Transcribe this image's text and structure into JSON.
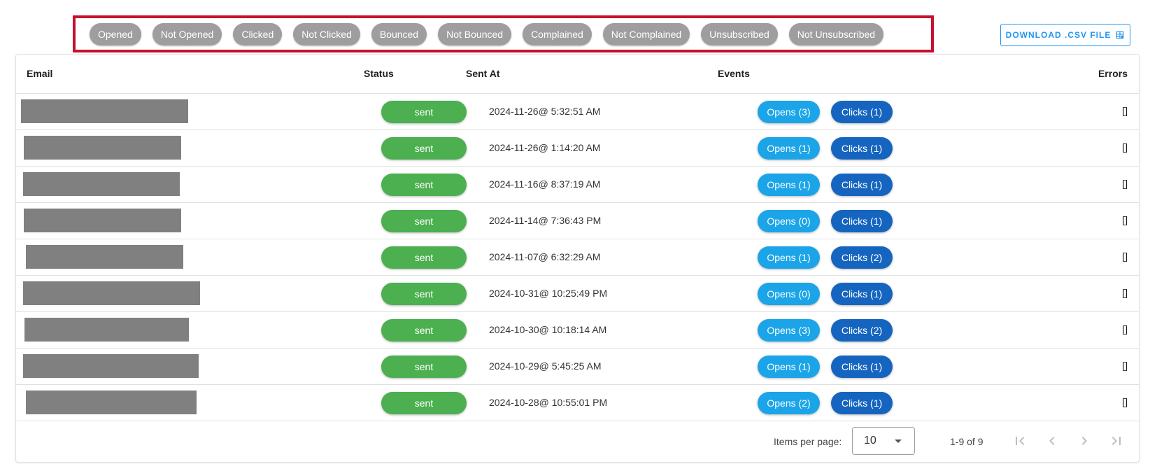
{
  "filters": [
    "Opened",
    "Not Opened",
    "Clicked",
    "Not Clicked",
    "Bounced",
    "Not Bounced",
    "Complained",
    "Not Complained",
    "Unsubscribed",
    "Not Unsubscribed"
  ],
  "download_label": "DOWNLOAD .CSV FILE",
  "columns": {
    "email": "Email",
    "status": "Status",
    "sent_at": "Sent At",
    "events": "Events",
    "errors": "Errors"
  },
  "rows": [
    {
      "status": "sent",
      "sent_at": "2024-11-26@ 5:32:51 AM",
      "opens": "Opens (3)",
      "clicks": "Clicks (1)",
      "errors": "[]"
    },
    {
      "status": "sent",
      "sent_at": "2024-11-26@ 1:14:20 AM",
      "opens": "Opens (1)",
      "clicks": "Clicks (1)",
      "errors": "[]"
    },
    {
      "status": "sent",
      "sent_at": "2024-11-16@ 8:37:19 AM",
      "opens": "Opens (1)",
      "clicks": "Clicks (1)",
      "errors": "[]"
    },
    {
      "status": "sent",
      "sent_at": "2024-11-14@ 7:36:43 PM",
      "opens": "Opens (0)",
      "clicks": "Clicks (1)",
      "errors": "[]"
    },
    {
      "status": "sent",
      "sent_at": "2024-11-07@ 6:32:29 AM",
      "opens": "Opens (1)",
      "clicks": "Clicks (2)",
      "errors": "[]"
    },
    {
      "status": "sent",
      "sent_at": "2024-10-31@ 10:25:49 PM",
      "opens": "Opens (0)",
      "clicks": "Clicks (1)",
      "errors": "[]"
    },
    {
      "status": "sent",
      "sent_at": "2024-10-30@ 10:18:14 AM",
      "opens": "Opens (3)",
      "clicks": "Clicks (2)",
      "errors": "[]"
    },
    {
      "status": "sent",
      "sent_at": "2024-10-29@ 5:45:25 AM",
      "opens": "Opens (1)",
      "clicks": "Clicks (1)",
      "errors": "[]"
    },
    {
      "status": "sent",
      "sent_at": "2024-10-28@ 10:55:01 PM",
      "opens": "Opens (2)",
      "clicks": "Clicks (1)",
      "errors": "[]"
    }
  ],
  "pagination": {
    "items_per_page_label": "Items per page:",
    "items_per_page": "10",
    "range": "1-9 of 9"
  },
  "colors": {
    "highlight_border": "#c8102e",
    "chip": "#9e9e9e",
    "status_sent": "#4caf50",
    "opens": "#1ba5e8",
    "clicks": "#1565c0",
    "download": "#2196f3"
  },
  "icons": {
    "download": "table-export-icon",
    "caret": "dropdown-caret-icon",
    "first": "first-page-icon",
    "prev": "chevron-left-icon",
    "next": "chevron-right-icon",
    "last": "last-page-icon"
  }
}
